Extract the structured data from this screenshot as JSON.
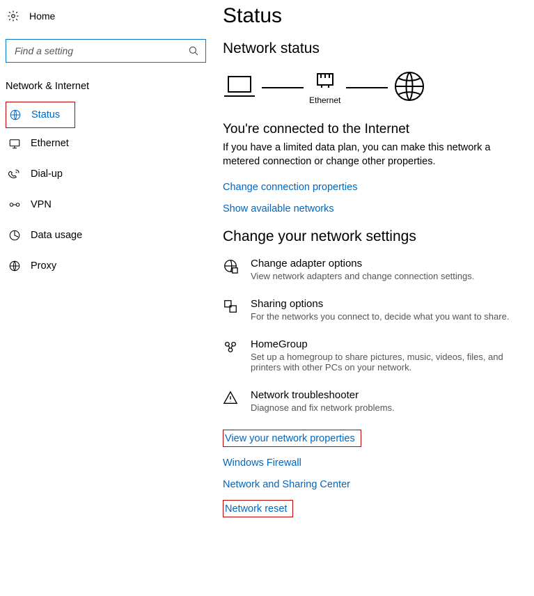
{
  "home_label": "Home",
  "search": {
    "placeholder": "Find a setting"
  },
  "category": "Network & Internet",
  "sidebar": {
    "items": [
      {
        "label": "Status"
      },
      {
        "label": "Ethernet"
      },
      {
        "label": "Dial-up"
      },
      {
        "label": "VPN"
      },
      {
        "label": "Data usage"
      },
      {
        "label": "Proxy"
      }
    ]
  },
  "page_title": "Status",
  "network_status": {
    "title": "Network status",
    "diagram": {
      "adapter_label": "Ethernet"
    },
    "headline": "You're connected to the Internet",
    "body": "If you have a limited data plan, you can make this network a metered connection or change other properties.",
    "link1": "Change connection properties",
    "link2": "Show available networks"
  },
  "change_settings": {
    "title": "Change your network settings",
    "rows": [
      {
        "title": "Change adapter options",
        "desc": "View network adapters and change connection settings."
      },
      {
        "title": "Sharing options",
        "desc": "For the networks you connect to, decide what you want to share."
      },
      {
        "title": "HomeGroup",
        "desc": "Set up a homegroup to share pictures, music, videos, files, and printers with other PCs on your network."
      },
      {
        "title": "Network troubleshooter",
        "desc": "Diagnose and fix network problems."
      }
    ],
    "links": [
      "View your network properties",
      "Windows Firewall",
      "Network and Sharing Center",
      "Network reset"
    ]
  }
}
